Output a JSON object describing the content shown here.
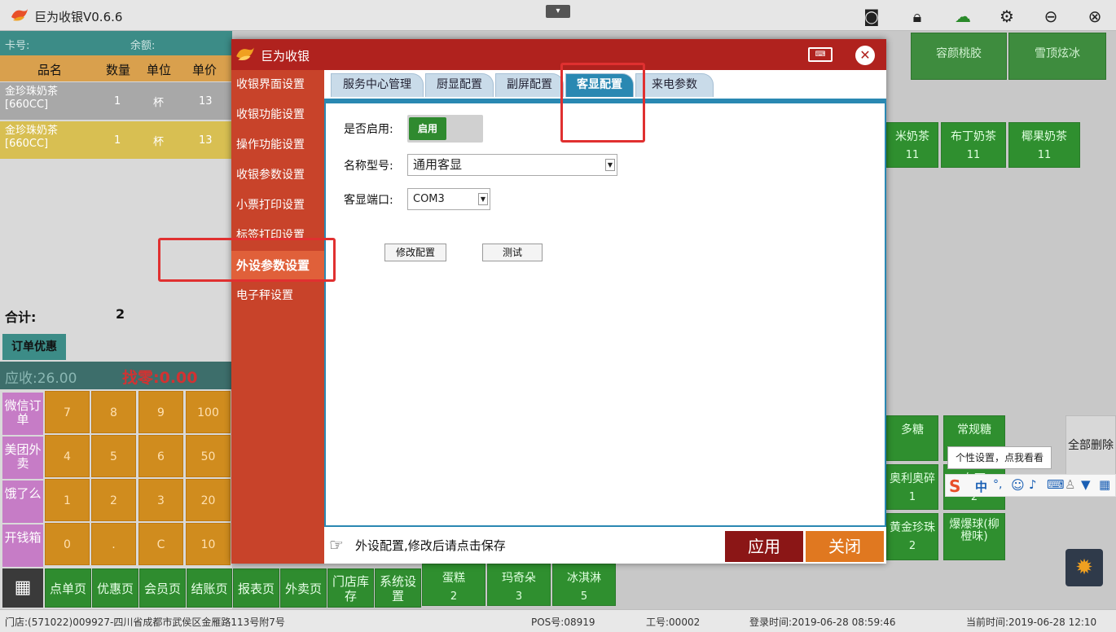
{
  "window": {
    "title": "巨为收银V0.6.6"
  },
  "left": {
    "card_label": "卡号:",
    "balance_label": "余额:",
    "headers": [
      "品名",
      "数量",
      "单位",
      "单价"
    ],
    "rows": [
      {
        "name": "金珍珠奶茶",
        "spec": "[660CC]",
        "qty": "1",
        "unit": "杯",
        "price": "13"
      },
      {
        "name": "金珍珠奶茶",
        "spec": "[660CC]",
        "qty": "1",
        "unit": "杯",
        "price": "13"
      }
    ],
    "total_label": "合计:",
    "total_qty": "2",
    "order_discount": "订单优惠",
    "due": "应收:26.00",
    "change": "找零:0.00",
    "side_buttons": [
      "微信订单",
      "美团外卖",
      "饿了么",
      "开钱箱"
    ],
    "keypad": [
      [
        "7",
        "8",
        "9",
        "100"
      ],
      [
        "4",
        "5",
        "6",
        "50"
      ],
      [
        "1",
        "2",
        "3",
        "20"
      ],
      [
        "0",
        ".",
        "C",
        "10"
      ]
    ],
    "nav": [
      "点单页",
      "优惠页",
      "会员页",
      "结账页",
      "报表页",
      "外卖页",
      "门店库存",
      "系统设置"
    ]
  },
  "products": {
    "top": [
      "容颜桃胶",
      "雪顶炫冰"
    ],
    "row2": [
      {
        "name": "米奶茶",
        "price": "11"
      },
      {
        "name": "布丁奶茶",
        "price": "11"
      },
      {
        "name": "椰果奶茶",
        "price": "11"
      }
    ],
    "bottom": [
      {
        "name": "蛋糕",
        "price": "2"
      },
      {
        "name": "玛奇朵",
        "price": "3"
      },
      {
        "name": "冰淇淋",
        "price": "5"
      }
    ],
    "sugar": [
      "多糖",
      "常规糖"
    ],
    "extras": [
      {
        "name": "奥利奥碎",
        "price": "1"
      },
      {
        "name": "布丁",
        "price": "2"
      },
      {
        "name": "黄金珍珠",
        "price": "2"
      },
      {
        "name": "爆爆球(柳橙味)",
        "price": ""
      }
    ],
    "delete_all": "全部删除"
  },
  "ime": {
    "tooltip": "个性设置，点我看看",
    "mode": "中"
  },
  "dialog": {
    "title": "巨为收银",
    "side_items": [
      "收银界面设置",
      "收银功能设置",
      "操作功能设置",
      "收银参数设置",
      "小票打印设置",
      "标签打印设置",
      "外设参数设置",
      "电子秤设置"
    ],
    "active_side": "外设参数设置",
    "tabs": [
      "服务中心管理",
      "厨显配置",
      "副屏配置",
      "客显配置",
      "来电参数"
    ],
    "active_tab": "客显配置",
    "enable_label": "是否启用:",
    "enable_state": "启用",
    "model_label": "名称型号:",
    "model_value": "通用客显",
    "port_label": "客显端口:",
    "port_value": "COM3",
    "modify_btn": "修改配置",
    "test_btn": "测试",
    "hint": "外设配置,修改后请点击保存",
    "apply": "应用",
    "close": "关闭"
  },
  "status": {
    "store": "门店:(571022)009927-四川省成都市武侯区金雁路113号附7号",
    "pos": "POS号:08919",
    "staff": "工号:00002",
    "login": "登录时间:2019-06-28 08:59:46",
    "now": "当前时间:2019-06-28 12:10"
  },
  "colors": {
    "dialog_red": "#b0221e",
    "tab_blue": "#2a88b2",
    "green": "#2f8f2f",
    "annotation_red": "#e03030"
  }
}
